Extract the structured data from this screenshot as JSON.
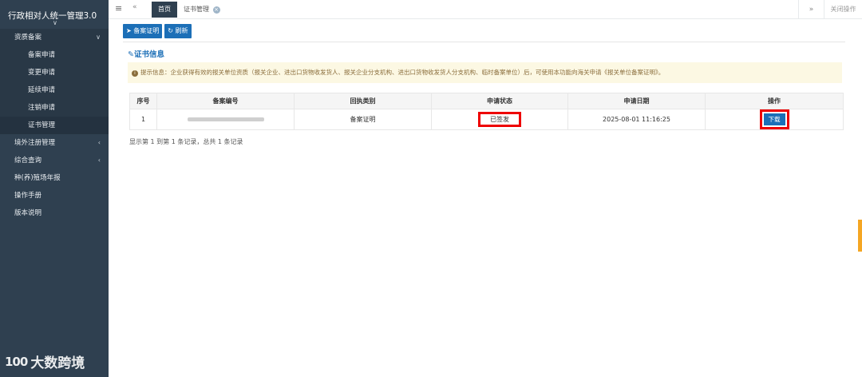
{
  "app": {
    "title": "行政相对人统一管理3.0",
    "collapse_icon": "chevron-down-icon"
  },
  "sidebar": {
    "groups": [
      {
        "label": "资质备案",
        "expanded": true,
        "children": [
          "备案申请",
          "变更申请",
          "延续申请",
          "注销申请",
          "证书管理"
        ]
      },
      {
        "label": "境外注册管理",
        "expanded": false
      },
      {
        "label": "综合查询",
        "expanded": false
      },
      {
        "label": "种(养)殖场年报"
      },
      {
        "label": "操作手册"
      },
      {
        "label": "版本说明"
      }
    ]
  },
  "tabs": {
    "home": "首页",
    "cert": "证书管理",
    "close_ops": "关闭操作"
  },
  "toolbar": {
    "apply_label": "备案证明",
    "refresh_label": "刷新"
  },
  "section": {
    "title": "证书信息"
  },
  "notice": {
    "text": "提示信息：企业获得有效的报关单位资质（报关企业、进出口货物收发货人、报关企业分支机构、进出口货物收发货人分支机构、临时备案单位）后，可使用本功能向海关申请《报关单位备案证明》。"
  },
  "table": {
    "headers": [
      "序号",
      "备案编号",
      "回执类别",
      "申请状态",
      "申请日期",
      "操作"
    ],
    "rows": [
      {
        "index": "1",
        "receipt_type": "备案证明",
        "status": "已签发",
        "date": "2025-08-01 11:16:25",
        "action": "下载"
      }
    ]
  },
  "summary": "显示第 1 到第 1 条记录，总共 1 条记录",
  "watermark": {
    "logo": "100",
    "text": "大数跨境"
  }
}
